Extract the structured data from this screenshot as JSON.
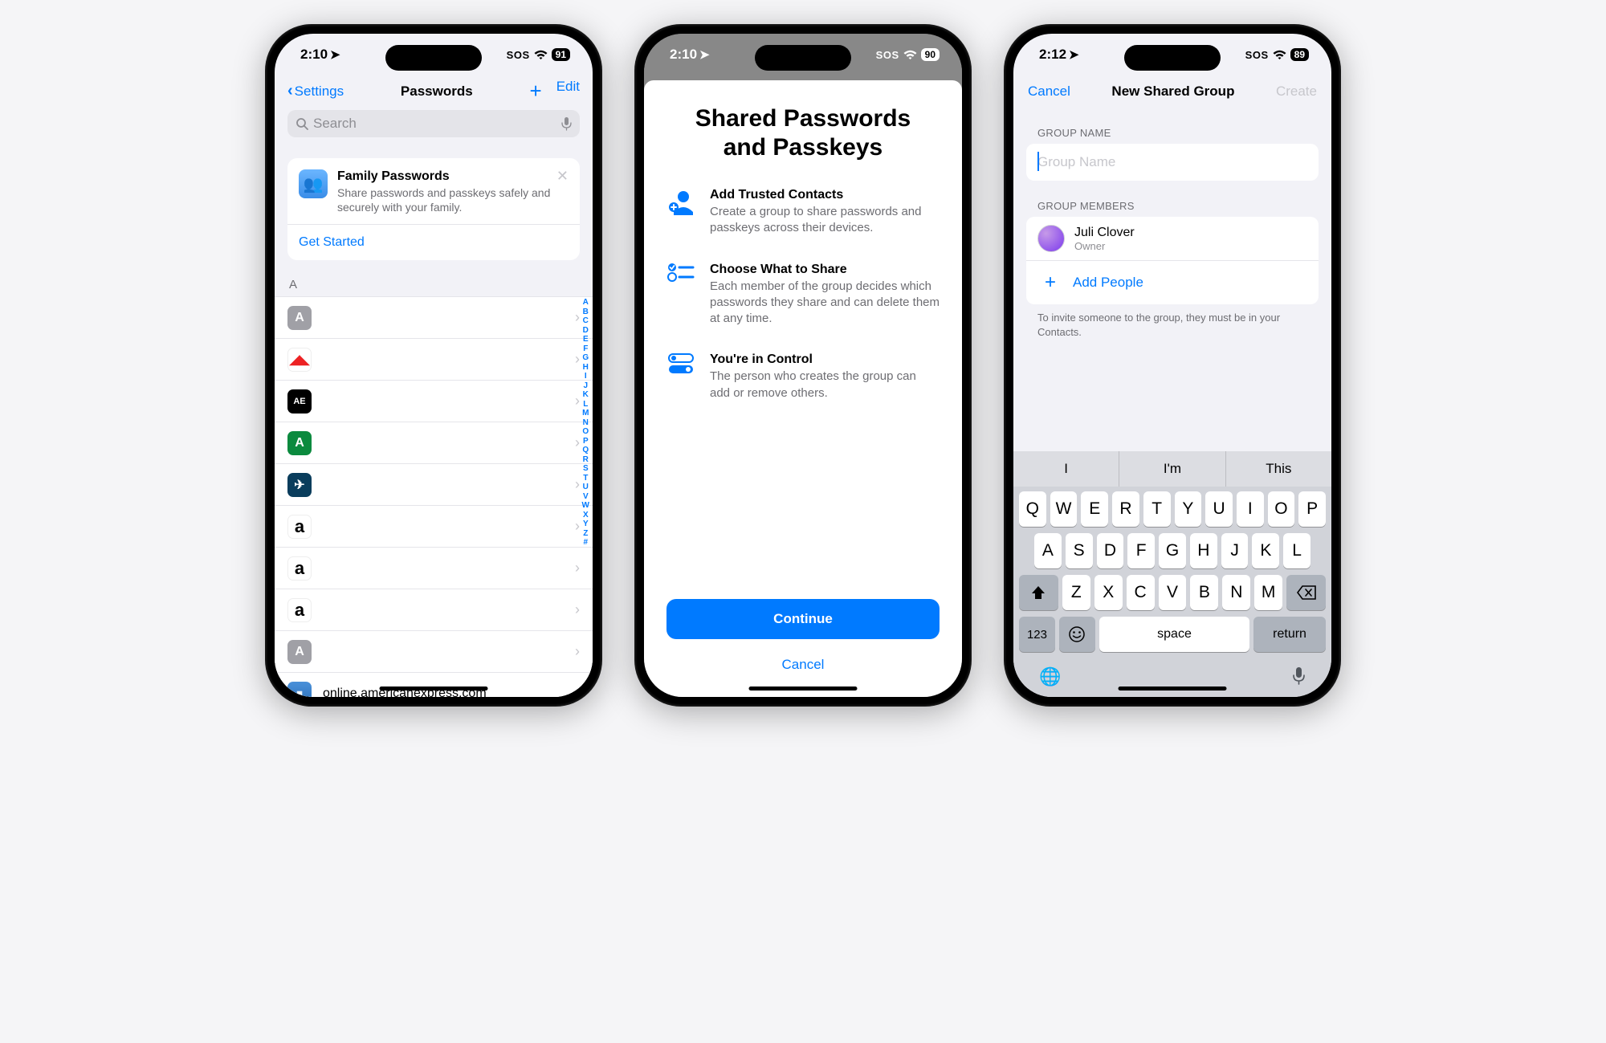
{
  "phone1": {
    "time": "2:10",
    "battery": "91",
    "sos": "SOS",
    "nav_back": "Settings",
    "nav_title": "Passwords",
    "nav_edit": "Edit",
    "search_placeholder": "Search",
    "card_title": "Family Passwords",
    "card_sub": "Share passwords and passkeys safely and securely with your family.",
    "card_action": "Get Started",
    "section_header": "A",
    "index": [
      "A",
      "B",
      "C",
      "D",
      "E",
      "F",
      "G",
      "H",
      "I",
      "J",
      "K",
      "L",
      "M",
      "N",
      "O",
      "P",
      "Q",
      "R",
      "S",
      "T",
      "U",
      "V",
      "W",
      "X",
      "Y",
      "Z",
      "#"
    ],
    "rows": [
      "",
      "",
      "",
      "",
      "",
      "",
      "",
      "",
      "online.americanexpress.com"
    ]
  },
  "phone2": {
    "time": "2:10",
    "battery": "90",
    "sos": "SOS",
    "title_l1": "Shared Passwords",
    "title_l2": "and Passkeys",
    "features": [
      {
        "title": "Add Trusted Contacts",
        "desc": "Create a group to share passwords and passkeys across their devices."
      },
      {
        "title": "Choose What to Share",
        "desc": "Each member of the group decides which passwords they share and can delete them at any time."
      },
      {
        "title": "You're in Control",
        "desc": "The person who creates the group can add or remove others."
      }
    ],
    "continue": "Continue",
    "cancel": "Cancel"
  },
  "phone3": {
    "time": "2:12",
    "battery": "89",
    "sos": "SOS",
    "cancel": "Cancel",
    "title": "New Shared Group",
    "create": "Create",
    "group_name_label": "GROUP NAME",
    "group_name_placeholder": "Group Name",
    "members_label": "GROUP MEMBERS",
    "member_name": "Juli Clover",
    "member_role": "Owner",
    "add_people": "Add People",
    "footer": "To invite someone to the group, they must be in your Contacts.",
    "suggestions": [
      "I",
      "I'm",
      "This"
    ],
    "keys_row1": [
      "Q",
      "W",
      "E",
      "R",
      "T",
      "Y",
      "U",
      "I",
      "O",
      "P"
    ],
    "keys_row2": [
      "A",
      "S",
      "D",
      "F",
      "G",
      "H",
      "J",
      "K",
      "L"
    ],
    "keys_row3": [
      "Z",
      "X",
      "C",
      "V",
      "B",
      "N",
      "M"
    ],
    "key_123": "123",
    "key_space": "space",
    "key_return": "return"
  }
}
